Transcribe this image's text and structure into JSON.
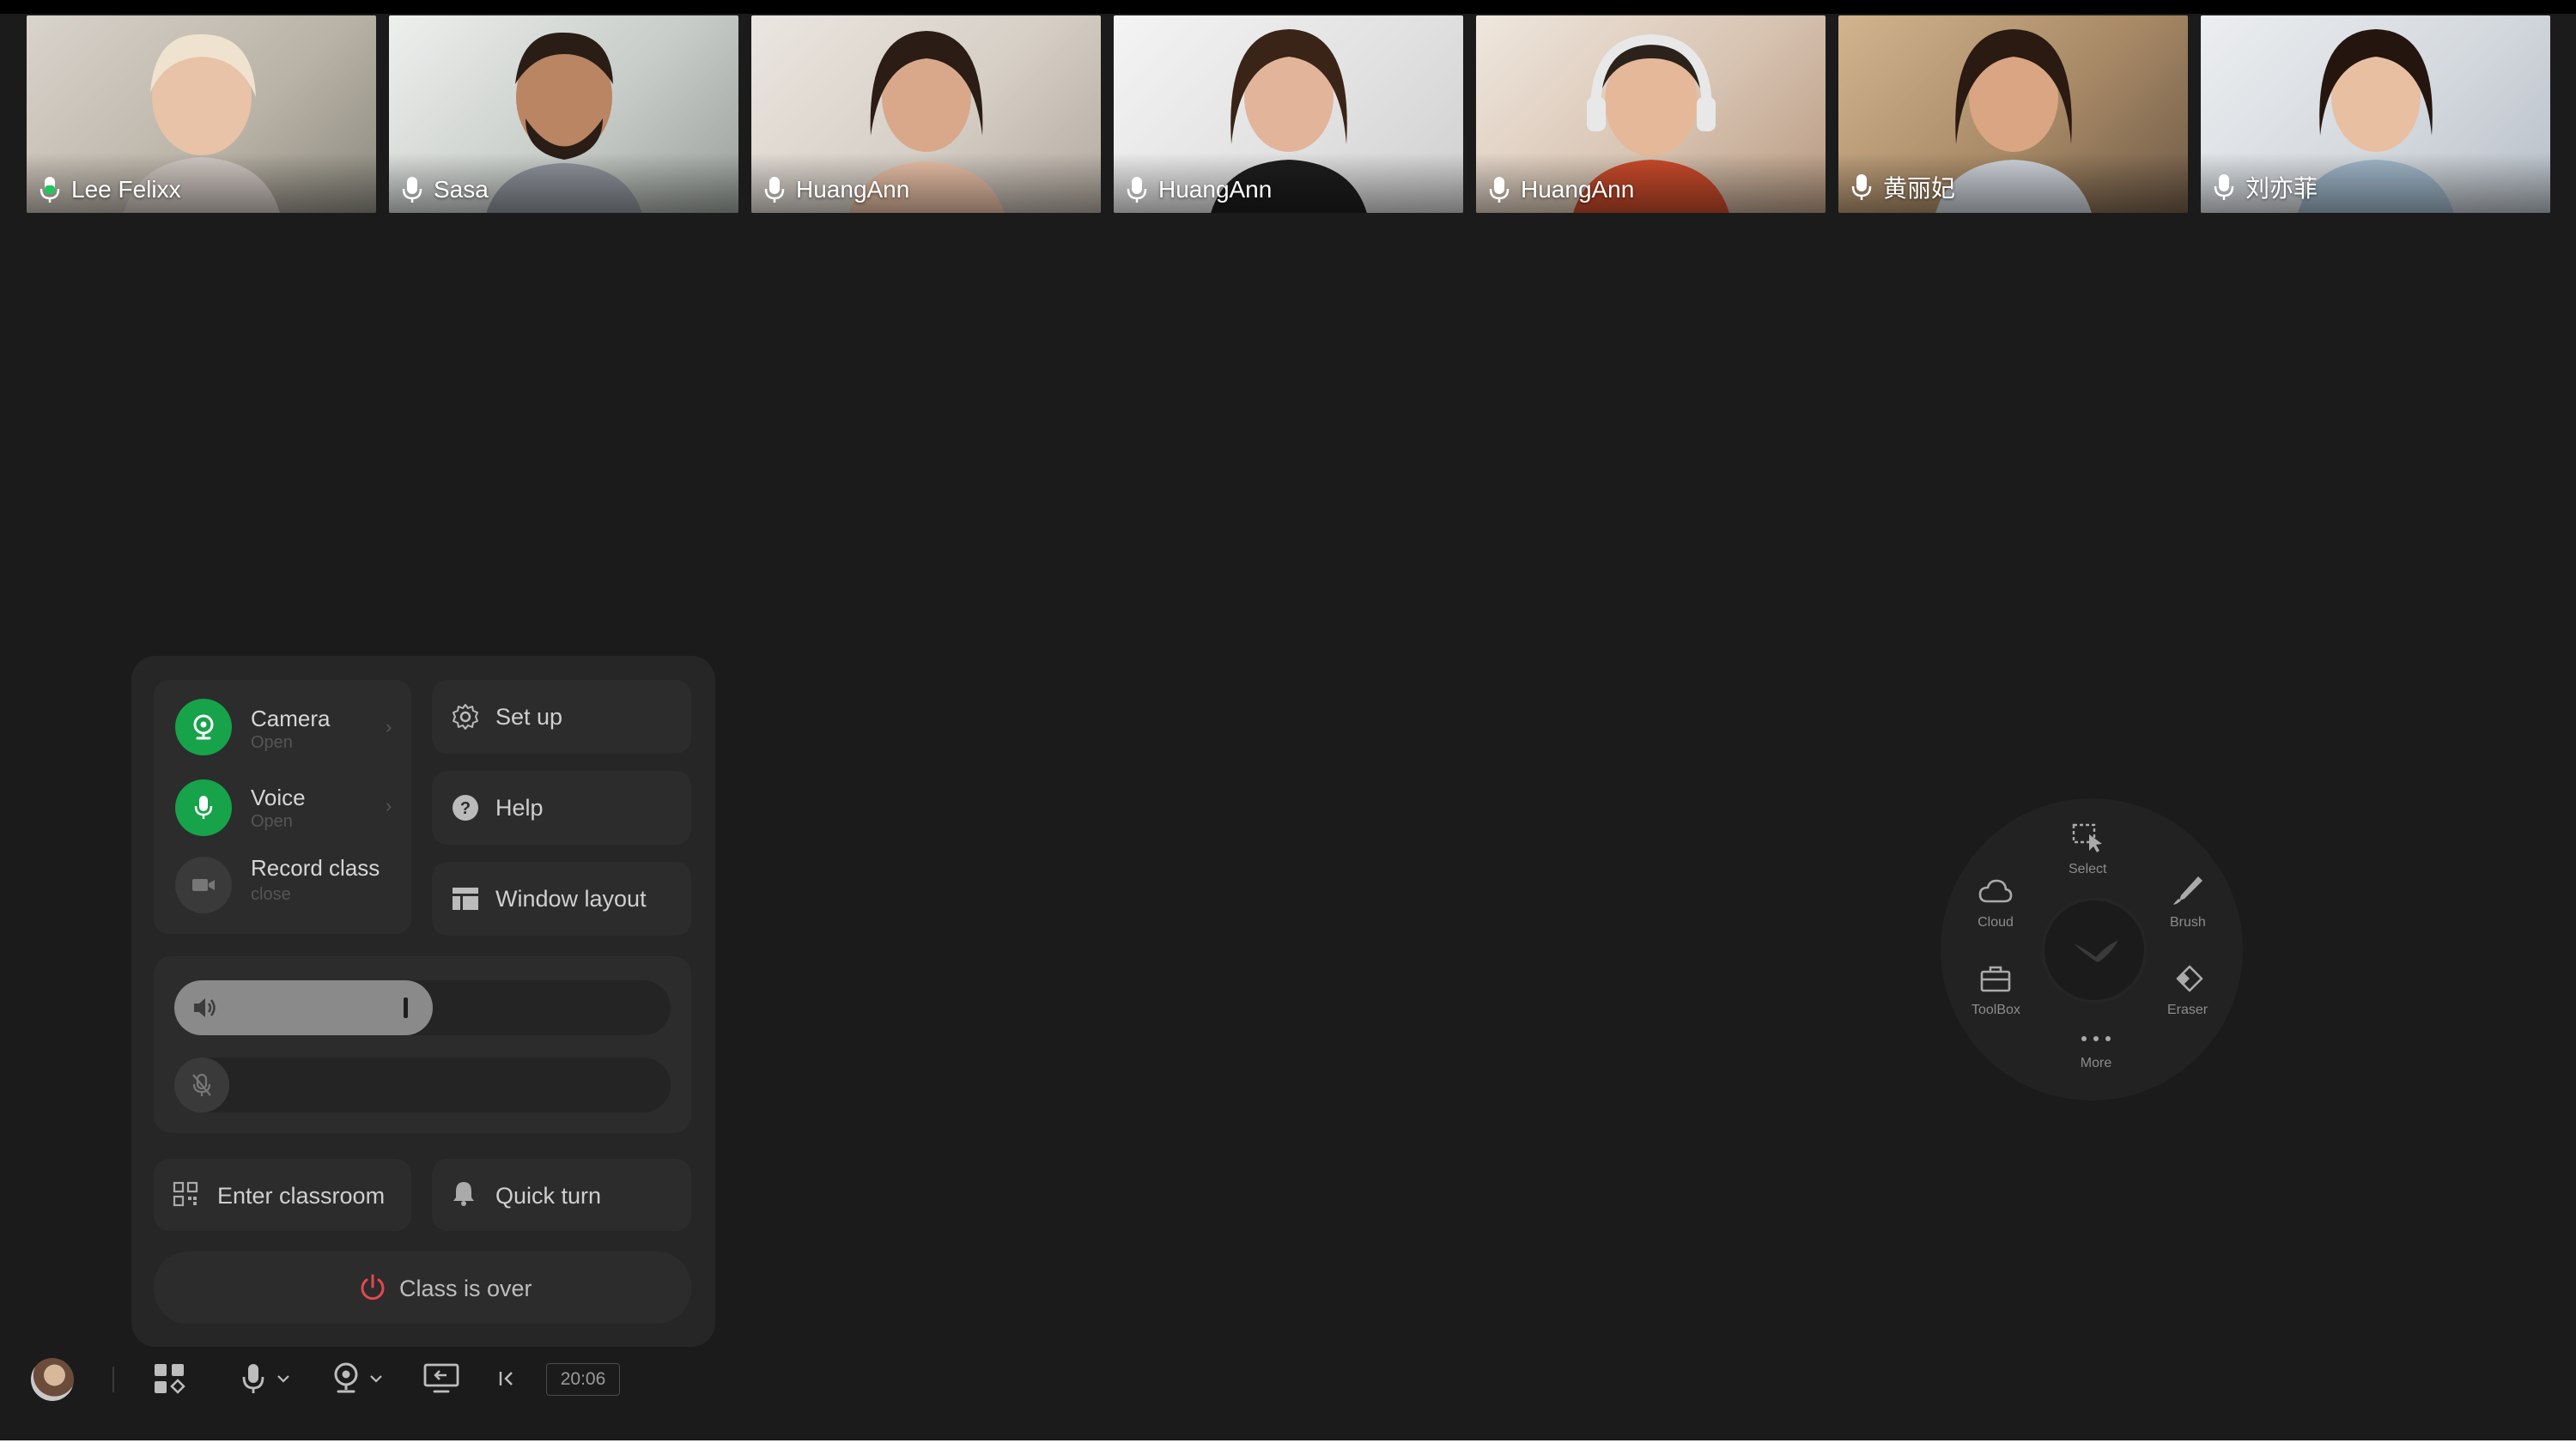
{
  "participants": [
    {
      "name": "Lee Felixx",
      "mic": "active"
    },
    {
      "name": "Sasa",
      "mic": "on"
    },
    {
      "name": "HuangAnn",
      "mic": "on"
    },
    {
      "name": "HuangAnn",
      "mic": "on"
    },
    {
      "name": "HuangAnn",
      "mic": "on"
    },
    {
      "name": "黄丽妃",
      "mic": "on"
    },
    {
      "name": "刘亦菲",
      "mic": "on"
    }
  ],
  "panel": {
    "camera": {
      "label": "Camera",
      "status": "Open"
    },
    "voice": {
      "label": "Voice",
      "status": "Open"
    },
    "record": {
      "label": "Record class",
      "status": "close"
    },
    "setup_label": "Set up",
    "help_label": "Help",
    "window_layout_label": "Window layout",
    "speaker_volume": 0.52,
    "mic_volume": 0.0,
    "enter_classroom_label": "Enter classroom",
    "quick_turn_label": "Quick turn",
    "class_over_label": "Class is over"
  },
  "toolbar": {
    "time": "20:06"
  },
  "wheel": {
    "select": "Select",
    "cloud": "Cloud",
    "brush": "Brush",
    "toolbox": "ToolBox",
    "eraser": "Eraser",
    "more": "More"
  },
  "colors": {
    "accent_green": "#16a34a",
    "danger_red": "#e5484d",
    "background": "#1b1b1b",
    "panel": "#262626"
  }
}
